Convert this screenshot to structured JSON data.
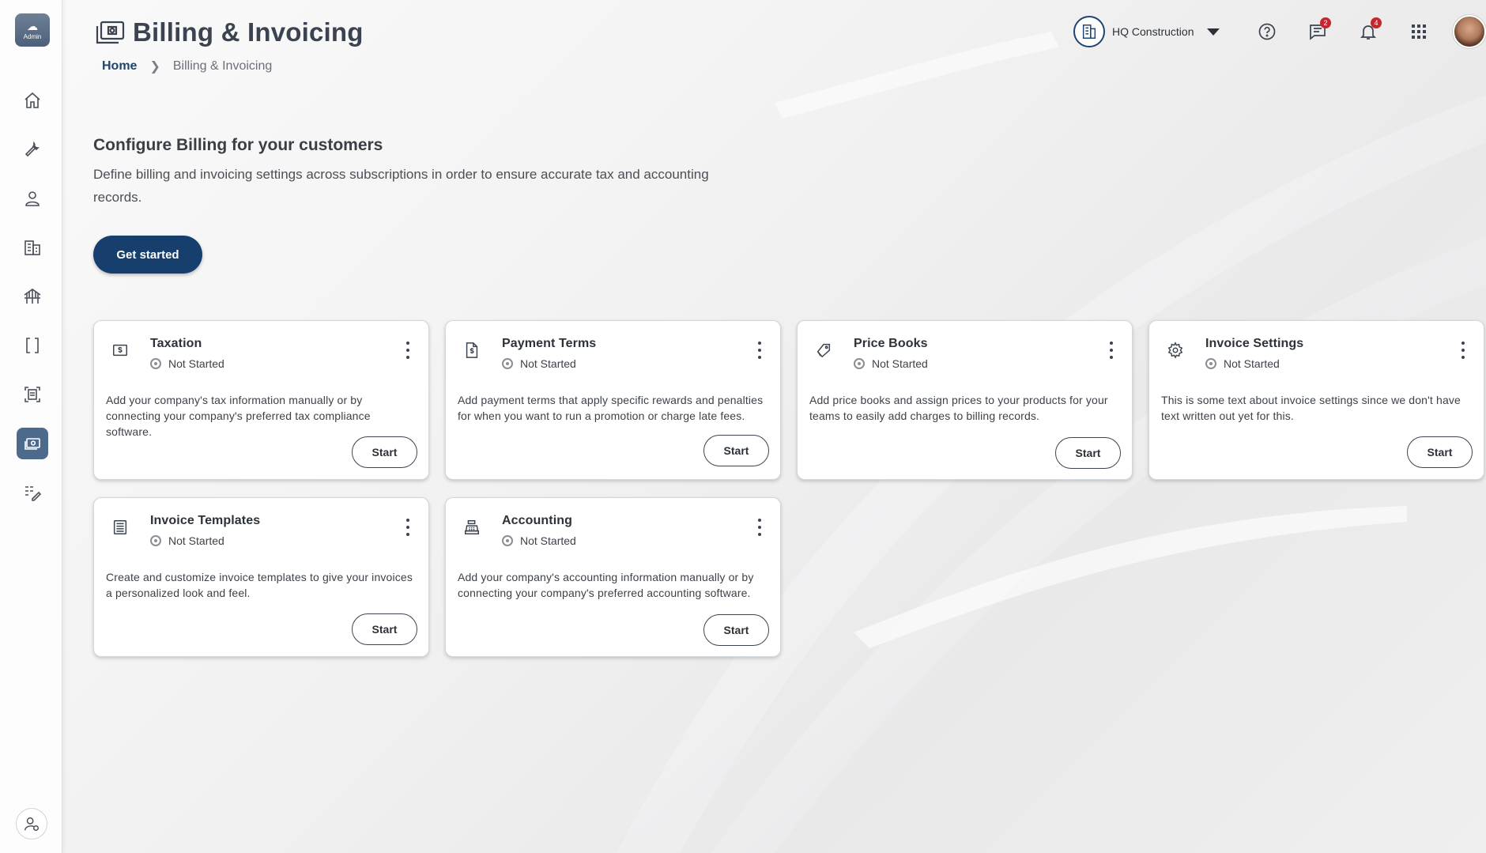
{
  "sidebar": {
    "logo_label": "Admin",
    "nav": [
      {
        "name": "home-icon"
      },
      {
        "name": "wrench-icon"
      },
      {
        "name": "user-icon"
      },
      {
        "name": "building-icon"
      },
      {
        "name": "bridge-icon"
      },
      {
        "name": "brackets-icon"
      },
      {
        "name": "document-scan-icon"
      },
      {
        "name": "billing-icon",
        "active": true
      },
      {
        "name": "edit-list-icon"
      }
    ],
    "bottom": {
      "name": "user-settings-icon"
    }
  },
  "header": {
    "title": "Billing & Invoicing",
    "breadcrumb": {
      "home": "Home",
      "separator": ">",
      "current": "Billing & Invoicing"
    },
    "org_name": "HQ Construction",
    "messages_badge": "2",
    "notifications_badge": "4"
  },
  "hero": {
    "title": "Configure Billing for your customers",
    "description": "Define billing and invoicing settings across subscriptions in order to ensure accurate tax and accounting records.",
    "cta": "Get started"
  },
  "cards": [
    {
      "title": "Taxation",
      "status": "Not Started",
      "description": "Add your company's tax information manually or by connecting your company's preferred tax compliance software.",
      "button": "Start",
      "icon": "tax-icon"
    },
    {
      "title": "Payment Terms",
      "status": "Not Started",
      "description": "Add payment terms that apply specific rewards and penalties for when you want to run a promotion or charge late fees.",
      "button": "Start",
      "icon": "payment-document-icon"
    },
    {
      "title": "Price Books",
      "status": "Not Started",
      "description": "Add price books and assign prices to your products for your teams to easily add charges to billing records.",
      "button": "Start",
      "icon": "price-tag-icon"
    },
    {
      "title": "Invoice Settings",
      "status": "Not Started",
      "description": "This is some text about invoice settings since we don't have text written out yet for this.",
      "button": "Start",
      "icon": "gear-icon"
    },
    {
      "title": "Invoice Templates",
      "status": "Not Started",
      "description": "Create and customize invoice templates to give your invoices a personalized look and feel.",
      "button": "Start",
      "icon": "template-list-icon"
    },
    {
      "title": "Accounting",
      "status": "Not Started",
      "description": "Add your company's accounting information manually or by connecting your company's preferred accounting software.",
      "button": "Start",
      "icon": "cash-register-icon"
    }
  ],
  "colors": {
    "primary": "#163f6d",
    "active_nav": "#4d6a8c",
    "badge": "#c4262e"
  }
}
